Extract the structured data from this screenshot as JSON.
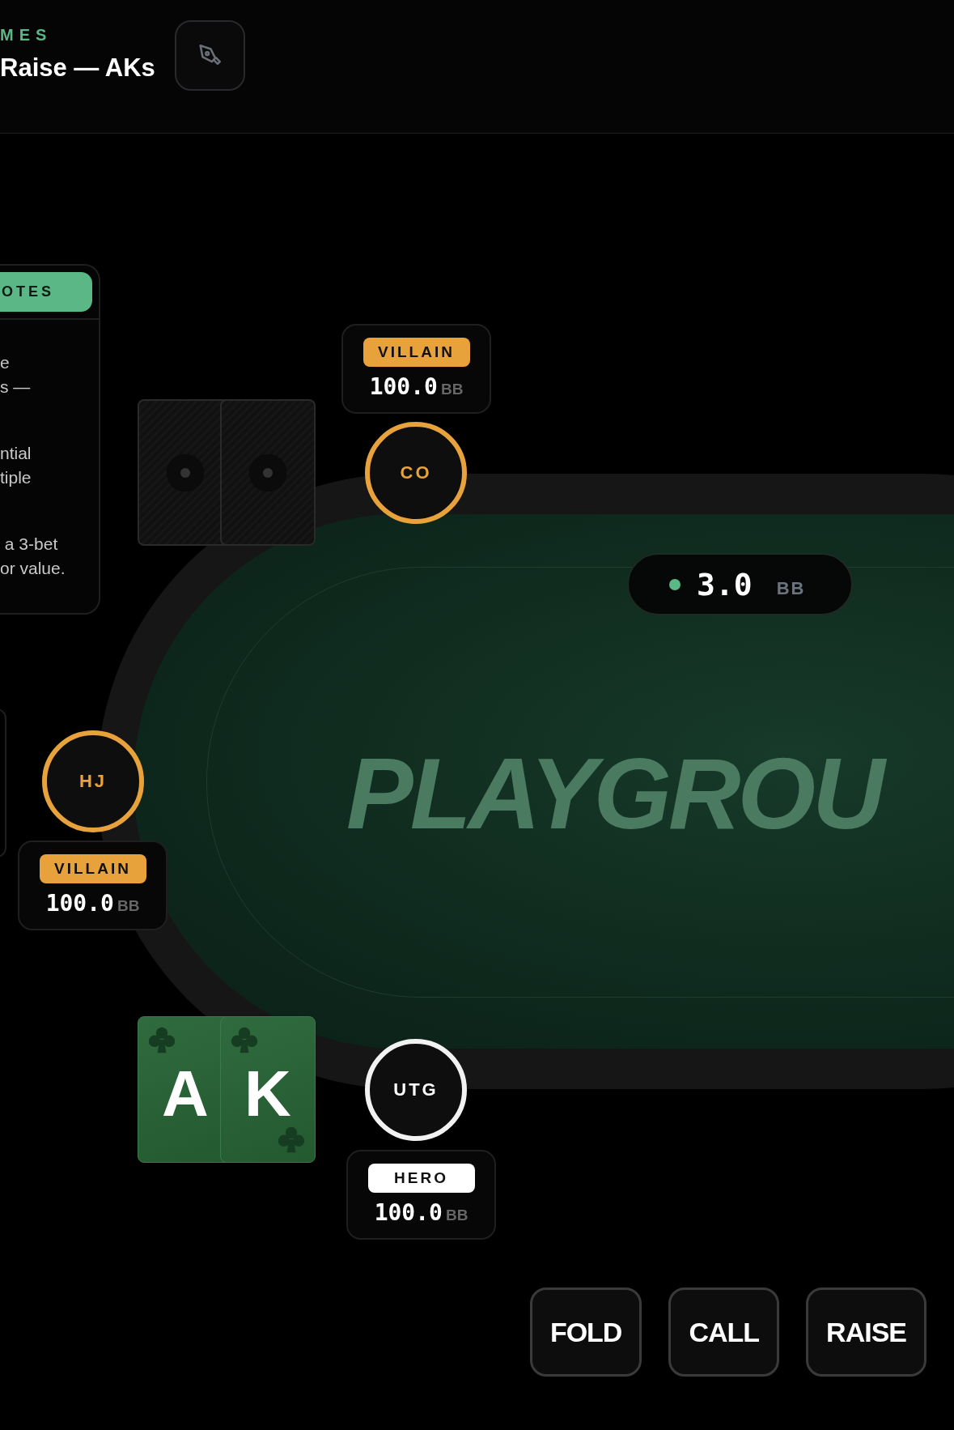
{
  "header": {
    "eyebrow": "MES",
    "title": "Raise — AKs"
  },
  "notes": {
    "heading": "OTES",
    "paragraphs": [
      "e\ns —",
      "ntial\ntiple",
      " a 3-bet\nor value."
    ]
  },
  "pot": {
    "amount": "3.0",
    "unit": "BB"
  },
  "watermark": "PLAYGROU",
  "seats": [
    {
      "position": "CO",
      "kind": "villain",
      "badge": "VILLAIN",
      "stack": "100.0",
      "unit": "BB",
      "cards": [
        {
          "kind": "back"
        },
        {
          "kind": "back"
        }
      ]
    },
    {
      "position": "HJ",
      "kind": "villain",
      "badge": "VILLAIN",
      "stack": "100.0",
      "unit": "BB"
    },
    {
      "position": "UTG",
      "kind": "hero",
      "badge": "HERO",
      "stack": "100.0",
      "unit": "BB",
      "cards": [
        {
          "kind": "club",
          "rank": "A"
        },
        {
          "kind": "club",
          "rank": "K"
        }
      ]
    }
  ],
  "actions": [
    "FOLD",
    "CALL",
    "RAISE"
  ]
}
